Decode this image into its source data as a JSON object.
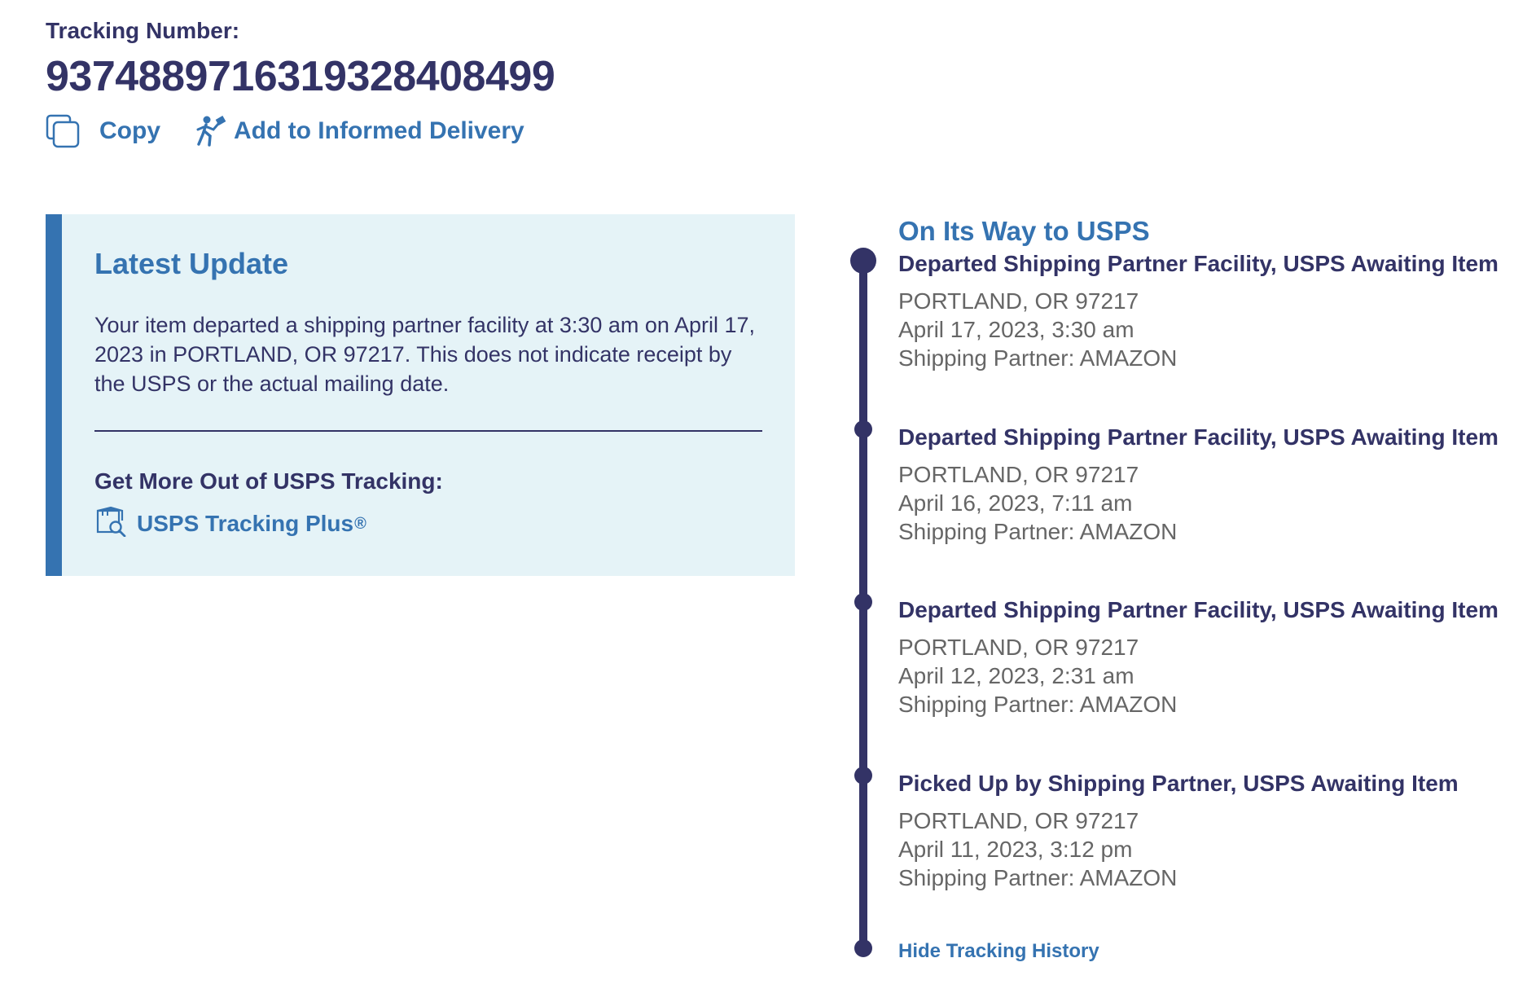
{
  "tracking": {
    "label": "Tracking Number:",
    "number": "9374889716319328408499"
  },
  "actions": {
    "copy": {
      "label": "Copy",
      "icon": "copy-icon"
    },
    "informed_delivery": {
      "label": "Add to Informed Delivery",
      "icon": "carrier-icon"
    }
  },
  "latest_update": {
    "title": "Latest Update",
    "text": "Your item departed a shipping partner facility at 3:30 am on April 17, 2023 in PORTLAND, OR 97217. This does not indicate receipt by the USPS or the actual mailing date.",
    "more_label": "Get More Out of USPS Tracking:",
    "plus_link": "USPS Tracking Plus",
    "plus_mark": "®",
    "plus_icon": "package-search-icon"
  },
  "history": {
    "stage": "On Its Way to USPS",
    "events": [
      {
        "title": "Departed Shipping Partner Facility, USPS Awaiting Item",
        "location": "PORTLAND, OR 97217",
        "datetime": "April 17, 2023, 3:30 am",
        "partner": "Shipping Partner: AMAZON"
      },
      {
        "title": "Departed Shipping Partner Facility, USPS Awaiting Item",
        "location": "PORTLAND, OR 97217",
        "datetime": "April 16, 2023, 7:11 am",
        "partner": "Shipping Partner: AMAZON"
      },
      {
        "title": "Departed Shipping Partner Facility, USPS Awaiting Item",
        "location": "PORTLAND, OR 97217",
        "datetime": "April 12, 2023, 2:31 am",
        "partner": "Shipping Partner: AMAZON"
      },
      {
        "title": "Picked Up by Shipping Partner, USPS Awaiting Item",
        "location": "PORTLAND, OR 97217",
        "datetime": "April 11, 2023, 3:12 pm",
        "partner": "Shipping Partner: AMAZON"
      }
    ],
    "hide_label": "Hide Tracking History"
  },
  "colors": {
    "navy": "#333366",
    "link_blue": "#3573b1",
    "panel_bg": "#e5f3f7",
    "detail_gray": "#666666"
  }
}
